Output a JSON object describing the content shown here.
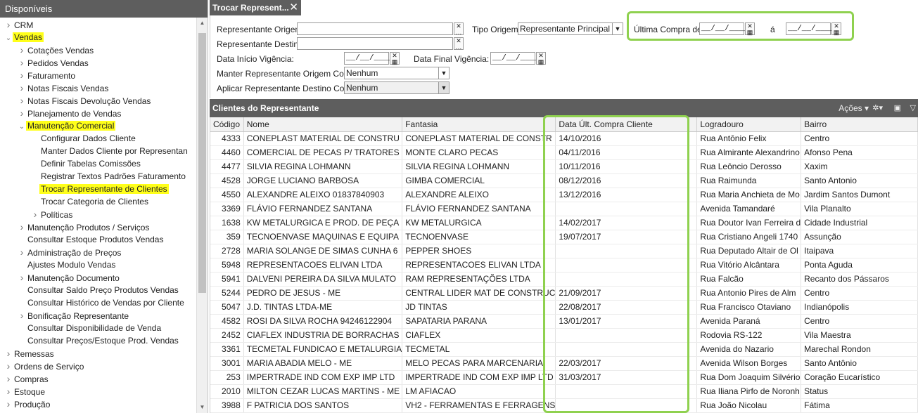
{
  "sidebar": {
    "title": "Disponíveis",
    "items": [
      {
        "label": "CRM",
        "level": 0,
        "arrow": "right",
        "highlight": false
      },
      {
        "label": "Vendas",
        "level": 0,
        "arrow": "down",
        "highlight": true
      },
      {
        "label": "Cotações Vendas",
        "level": 1,
        "arrow": "right",
        "highlight": false
      },
      {
        "label": "Pedidos Vendas",
        "level": 1,
        "arrow": "right",
        "highlight": false
      },
      {
        "label": "Faturamento",
        "level": 1,
        "arrow": "right",
        "highlight": false
      },
      {
        "label": "Notas Fiscais Vendas",
        "level": 1,
        "arrow": "right",
        "highlight": false
      },
      {
        "label": "Notas Fiscais Devolução Vendas",
        "level": 1,
        "arrow": "right",
        "highlight": false
      },
      {
        "label": "Planejamento de Vendas",
        "level": 1,
        "arrow": "right",
        "highlight": false
      },
      {
        "label": "Manutenção Comercial",
        "level": 1,
        "arrow": "down",
        "highlight": true
      },
      {
        "label": "Configurar Dados Cliente",
        "level": 2,
        "arrow": "",
        "highlight": false
      },
      {
        "label": "Manter Dados Cliente por Representan",
        "level": 2,
        "arrow": "",
        "highlight": false
      },
      {
        "label": "Definir Tabelas Comissões",
        "level": 2,
        "arrow": "",
        "highlight": false
      },
      {
        "label": "Registrar Textos Padrões Faturamento",
        "level": 2,
        "arrow": "",
        "highlight": false
      },
      {
        "label": "Trocar Representante de Clientes",
        "level": 2,
        "arrow": "",
        "highlight": true
      },
      {
        "label": "Trocar Categoria de Clientes",
        "level": 2,
        "arrow": "",
        "highlight": false
      },
      {
        "label": "Políticas",
        "level": 2,
        "arrow": "right",
        "highlight": false
      },
      {
        "label": "Manutenção Produtos / Serviços",
        "level": 1,
        "arrow": "right",
        "highlight": false
      },
      {
        "label": "Consultar Estoque Produtos Vendas",
        "level": 1,
        "arrow": "",
        "highlight": false
      },
      {
        "label": "Administração de Preços",
        "level": 1,
        "arrow": "right",
        "highlight": false
      },
      {
        "label": "Ajustes Modulo Vendas",
        "level": 1,
        "arrow": "",
        "highlight": false
      },
      {
        "label": "Manutenção Documento",
        "level": 1,
        "arrow": "right",
        "highlight": false
      },
      {
        "label": "Consultar Saldo Preço Produtos Vendas",
        "level": 1,
        "arrow": "",
        "highlight": false
      },
      {
        "label": "Consultar Histórico de Vendas por Cliente",
        "level": 1,
        "arrow": "",
        "highlight": false
      },
      {
        "label": "Bonificação Representante",
        "level": 1,
        "arrow": "right",
        "highlight": false
      },
      {
        "label": "Consultar Disponibilidade de Venda",
        "level": 1,
        "arrow": "",
        "highlight": false
      },
      {
        "label": "Consultar Preços/Estoque Prod. Vendas",
        "level": 1,
        "arrow": "",
        "highlight": false
      },
      {
        "label": "Remessas",
        "level": 0,
        "arrow": "right",
        "highlight": false
      },
      {
        "label": "Ordens de Serviço",
        "level": 0,
        "arrow": "right",
        "highlight": false
      },
      {
        "label": "Compras",
        "level": 0,
        "arrow": "right",
        "highlight": false
      },
      {
        "label": "Estoque",
        "level": 0,
        "arrow": "right",
        "highlight": false
      },
      {
        "label": "Produção",
        "level": 0,
        "arrow": "right",
        "highlight": false
      }
    ]
  },
  "tab": {
    "label": "Trocar Represent...",
    "close": "✕"
  },
  "form": {
    "rep_origem_label": "Representante Origem:",
    "rep_origem_value": "",
    "tipo_origem_label": "Tipo Origem:",
    "tipo_origem_value": "Representante Principal",
    "ultima_compra_label": "Última Compra de:",
    "ultima_compra_de": "__/__/____",
    "a_label": "á",
    "ultima_compra_ate": "__/__/____",
    "rep_destino_label": "Representante Destino:",
    "rep_destino_value": "",
    "data_inicio_label": "Data Início Vigência:",
    "data_inicio_value": "__/__/____",
    "data_final_label": "Data Final Vigência:",
    "data_final_value": "__/__/____",
    "manter_label": "Manter Representante Origem Como:",
    "manter_value": "Nenhum",
    "aplicar_label": "Aplicar Representante Destino Como:",
    "aplicar_value": "Nenhum"
  },
  "grid": {
    "title": "Clientes do Representante",
    "actions_label": "Ações",
    "columns": [
      "Código",
      "Nome",
      "Fantasia",
      "Data Últ. Compra Cliente",
      "Logradouro",
      "Bairro"
    ],
    "rows": [
      [
        "4333",
        "CONEPLAST MATERIAL DE CONSTRU",
        "CONEPLAST MATERIAL DE CONSTR",
        "14/10/2016",
        "Rua Antônio Felix",
        "Centro"
      ],
      [
        "4460",
        "COMERCIAL DE PECAS P/ TRATORES",
        "MONTE CLARO PECAS",
        "04/11/2016",
        "Rua Almirante Alexandrino",
        "Afonso Pena"
      ],
      [
        "4477",
        "SILVIA REGINA LOHMANN",
        "SILVIA REGINA LOHMANN",
        "10/11/2016",
        "Rua Leôncio Derosso",
        "Xaxim"
      ],
      [
        "4528",
        "JORGE LUCIANO BARBOSA",
        "GIMBA COMERCIAL",
        "08/12/2016",
        "Rua Raimunda",
        "Santo Antonio"
      ],
      [
        "4550",
        "ALEXANDRE ALEIXO 01837840903",
        "ALEXANDRE ALEIXO",
        "13/12/2016",
        "Rua Maria Anchieta de Mo",
        "Jardim Santos Dumont"
      ],
      [
        "3369",
        "FLÁVIO FERNANDEZ SANTANA",
        "FLÁVIO FERNANDEZ SANTANA",
        "",
        "Avenida Tamandaré",
        "Vila Planalto"
      ],
      [
        "1638",
        "KW METALURGICA E PROD. DE PEÇA",
        "KW METALURGICA",
        "14/02/2017",
        "Rua Doutor Ivan Ferreira d",
        "Cidade Industrial"
      ],
      [
        "359",
        "TECNOENVASE MAQUINAS E EQUIPA",
        "TECNOENVASE",
        "19/07/2017",
        "Rua Cristiano Angeli 1740",
        "Assunção"
      ],
      [
        "2728",
        "MARIA SOLANGE DE SIMAS CUNHA 6",
        "PEPPER SHOES",
        "",
        "Rua Deputado Altair de Ol",
        "Itaipava"
      ],
      [
        "5948",
        "REPRESENTACOES ELIVAN LTDA",
        "REPRESENTACOES ELIVAN LTDA",
        "",
        "Rua Vitório Alcântara",
        "Ponta Aguda"
      ],
      [
        "5941",
        "DALVENI PEREIRA DA SILVA MULATO",
        "RAM REPRESENTAÇÕES LTDA",
        "",
        "Rua Falcão",
        "Recanto dos Pássaros"
      ],
      [
        "5244",
        "PEDRO DE JESUS - ME",
        "CENTRAL LIDER MAT DE CONSTRUC",
        "21/09/2017",
        "Rua Antonio Pires de Alm",
        "Centro"
      ],
      [
        "5047",
        "J.D. TINTAS LTDA-ME",
        "JD TINTAS",
        "22/08/2017",
        "Rua Francisco Otaviano",
        "Indianópolis"
      ],
      [
        "4582",
        "ROSI DA SILVA ROCHA 94246122904",
        "SAPATARIA PARANA",
        "13/01/2017",
        "Avenida Paraná",
        "Centro"
      ],
      [
        "2452",
        "CIAFLEX INDUSTRIA DE BORRACHAS",
        "CIAFLEX",
        "",
        "Rodovia RS-122",
        "Vila Maestra"
      ],
      [
        "3361",
        "TECMETAL FUNDICAO E METALURGIA",
        "TECMETAL",
        "",
        "Avenida do Nazario",
        "Marechal Rondon"
      ],
      [
        "3001",
        "MARIA ABADIA MELO - ME",
        "MELO PECAS PARA MARCENARIA",
        "22/03/2017",
        "Avenida Wilson Borges",
        "Santo Antônio"
      ],
      [
        "253",
        "IMPERTRADE IND COM EXP IMP LTD",
        "IMPERTRADE IND COM EXP IMP LTD",
        "31/03/2017",
        "Rua Dom Joaquim Silvério",
        "Coração Eucarístico"
      ],
      [
        "2010",
        "MILTON CEZAR LUCAS MARTINS - ME",
        "LM AFIACAO",
        "",
        "Rua Iliana Pirfo de Noronh",
        "Status"
      ],
      [
        "3988",
        "F PATRICIA DOS SANTOS",
        "VH2 - FERRAMENTAS E FERRAGENS",
        "",
        "Rua João Nicolau",
        "Fátima"
      ]
    ]
  },
  "colors": {
    "header_bg": "#5e5e5e",
    "highlight_yellow": "#ffff1a",
    "annotation_green": "#8fd14f"
  }
}
